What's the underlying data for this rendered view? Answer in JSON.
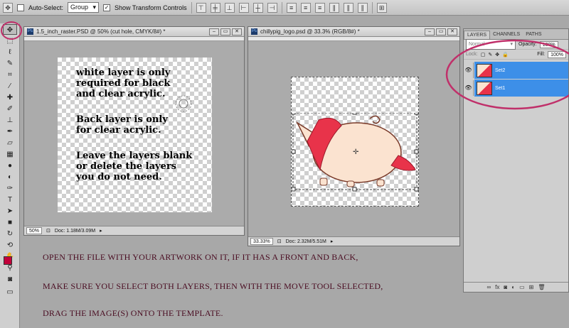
{
  "options_bar": {
    "auto_select_label": "Auto-Select:",
    "auto_select_value": "Group",
    "show_transform_label": "Show Transform Controls"
  },
  "toolbox": {
    "tools": [
      "move-tool",
      "marquee-tool",
      "lasso-tool",
      "quick-select-tool",
      "crop-tool",
      "eyedropper-tool",
      "healing-tool",
      "brush-tool",
      "stamp-tool",
      "history-brush-tool",
      "eraser-tool",
      "gradient-tool",
      "blur-tool",
      "dodge-tool",
      "pen-tool",
      "type-tool",
      "path-select-tool",
      "shape-tool",
      "3d-rotate-tool",
      "3d-camera-tool",
      "hand-tool",
      "zoom-tool"
    ],
    "foreground_color": "#c2003a",
    "background_color": "#ffffff"
  },
  "doc1": {
    "title": "1.5_inch_raster.PSD @ 50% (cut hole, CMYK/8#) *",
    "lines": "white layer is only\nrequired for black\nand clear acrylic.",
    "lines2": "Back layer is only\nfor clear acrylic.",
    "lines3": "Leave the layers blank\nor delete the layers\nyou do not need.",
    "zoom": "50%",
    "doc_info": "Doc: 1.18M/3.09M"
  },
  "doc2": {
    "title": "chillypig_logo.psd @ 33.3% (RGB/8#) *",
    "zoom": "33.33%",
    "doc_info": "Doc: 2.32M/5.51M"
  },
  "layers_panel": {
    "tabs": [
      "LAYERS",
      "CHANNELS",
      "PATHS"
    ],
    "blend_mode": "Normal",
    "opacity_label": "Opacity:",
    "opacity_value": "100%",
    "lock_label": "Lock:",
    "fill_label": "Fill:",
    "fill_value": "100%",
    "layers": [
      {
        "name": "Set2",
        "selected": true
      },
      {
        "name": "Set1",
        "selected": true
      }
    ]
  },
  "instructions": {
    "line1": "OPEN THE FILE WITH YOUR ARTWORK ON IT, IF IT HAS A FRONT AND BACK,",
    "line2": "MAKE SURE YOU SELECT BOTH LAYERS, THEN WITH THE MOVE TOOL SELECTED,",
    "line3": "DRAG THE IMAGE(S) ONTO THE TEMPLATE."
  },
  "colors": {
    "annotation": "#c0306a",
    "selection": "#3d8fe8"
  }
}
